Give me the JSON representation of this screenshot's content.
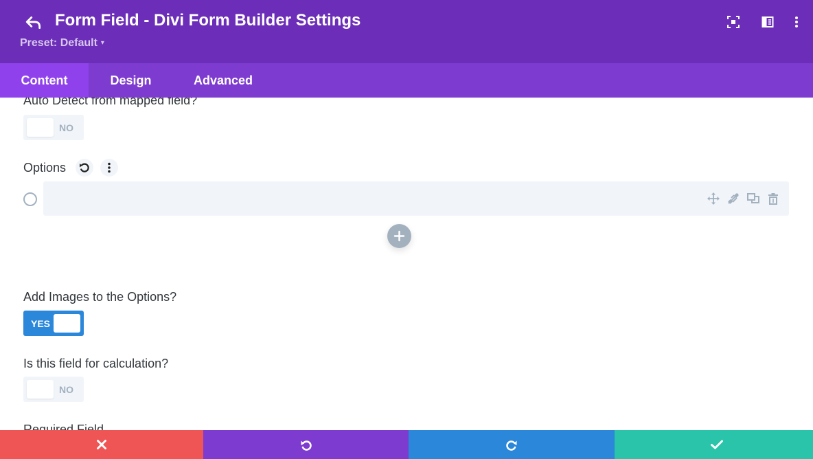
{
  "header": {
    "title": "Form Field - Divi Form Builder Settings",
    "preset_label": "Preset: Default",
    "caret": "▾",
    "icons": [
      "back-arrow-icon",
      "focus-icon",
      "split-view-icon",
      "more-vertical-icon"
    ]
  },
  "tabs": [
    {
      "label": "Content",
      "active": true
    },
    {
      "label": "Design",
      "active": false
    },
    {
      "label": "Advanced",
      "active": false
    }
  ],
  "content": {
    "auto_detect": {
      "label": "Auto Detect from mapped field?",
      "toggle_text": "NO",
      "value": false
    },
    "options": {
      "label": "Options",
      "icons": [
        "reset-icon",
        "more-vertical-icon"
      ],
      "rows": [
        {
          "value": "",
          "row_icons": [
            "move-icon",
            "link-off-icon",
            "duplicate-icon",
            "trash-icon"
          ]
        }
      ],
      "add_icon": "plus-icon"
    },
    "add_images": {
      "label": "Add Images to the Options?",
      "toggle_text": "YES",
      "value": true
    },
    "calculation": {
      "label": "Is this field for calculation?",
      "toggle_text": "NO",
      "value": false
    },
    "required": {
      "label": "Required Field"
    }
  },
  "footer": {
    "buttons": [
      {
        "name": "discard",
        "icon": "close-icon",
        "color": "#ef5555"
      },
      {
        "name": "undo",
        "icon": "undo-icon",
        "color": "#7e3bd0"
      },
      {
        "name": "redo",
        "icon": "redo-icon",
        "color": "#2b87da"
      },
      {
        "name": "save",
        "icon": "check-icon",
        "color": "#29c4a9"
      }
    ]
  },
  "colors": {
    "header_bg": "#6c2eb9",
    "tabs_bg": "#7e3bd0",
    "active_tab_bg": "#8f42ec",
    "toggle_on": "#2b87da",
    "toggle_off": "#f1f5f9",
    "muted_icon": "#a3b1bf"
  }
}
